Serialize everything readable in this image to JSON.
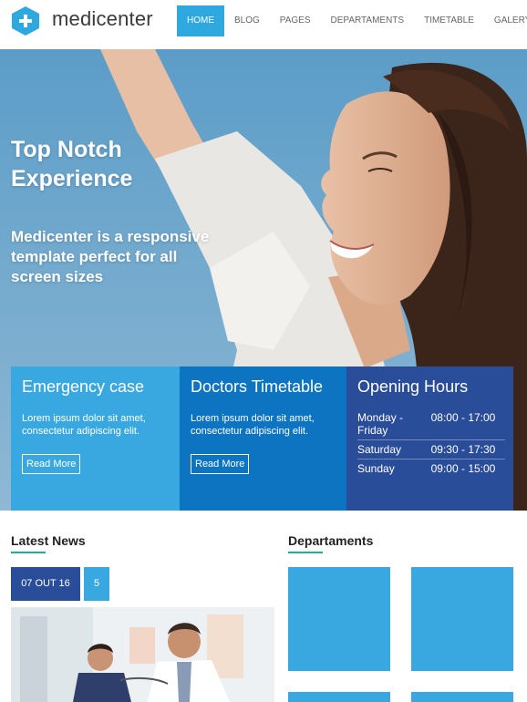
{
  "brand": {
    "name": "medicenter",
    "accent": "#2fa8e0"
  },
  "nav": {
    "items": [
      {
        "label": "HOME",
        "active": true
      },
      {
        "label": "BLOG",
        "active": false
      },
      {
        "label": "PAGES",
        "active": false
      },
      {
        "label": "DEPARTAMENTS",
        "active": false
      },
      {
        "label": "TIMETABLE",
        "active": false
      },
      {
        "label": "GALERY",
        "active": false
      }
    ]
  },
  "hero": {
    "title": "Top Notch Experience",
    "subtitle": "Medicenter is a responsive template perfect for all screen sizes"
  },
  "boxes": {
    "emergency": {
      "title": "Emergency case",
      "text": "Lorem ipsum dolor sit amet, consectetur adipiscing elit.",
      "button": "Read More",
      "color": "#3aa8e0"
    },
    "timetable": {
      "title": "Doctors Timetable",
      "text": "Lorem ipsum dolor sit amet, consectetur adipiscing elit.",
      "button": "Read More",
      "color": "#0d74c2"
    },
    "hours": {
      "title": "Opening Hours",
      "color": "#2a4d9a",
      "rows": [
        {
          "day": "Monday - Friday",
          "time": "08:00 - 17:00"
        },
        {
          "day": "Saturday",
          "time": "09:30 - 17:30"
        },
        {
          "day": "Sunday",
          "time": "09:00 - 15:00"
        }
      ]
    }
  },
  "news": {
    "title": "Latest News",
    "date": "07 OUT 16",
    "comments": "5"
  },
  "departments": {
    "title": "Departaments",
    "tile_color": "#3aa8e0"
  }
}
